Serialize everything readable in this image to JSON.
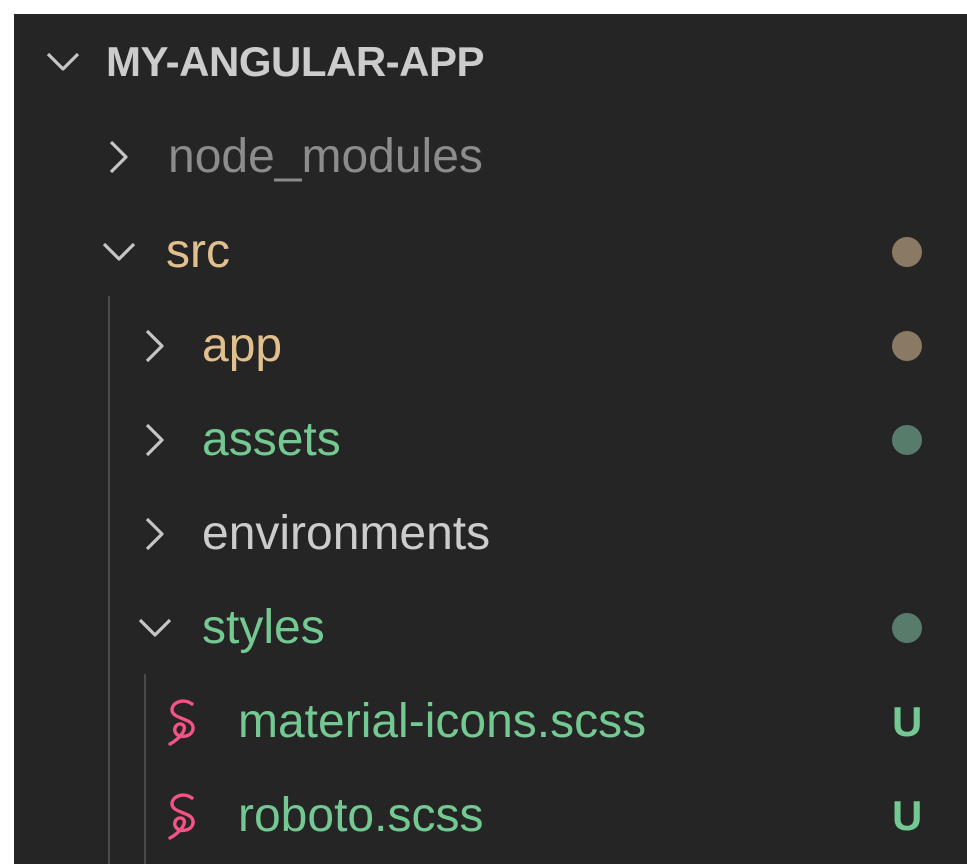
{
  "colors": {
    "background": "#252526",
    "header_text": "#cccccc",
    "chevron": "#c5c5c5",
    "ignored_text": "#8c8c8c",
    "modified_text": "#e2c08d",
    "untracked_text": "#73c991",
    "default_text": "#cccccc",
    "modified_dot": "#8a7a63",
    "untracked_dot": "#587c6c",
    "sass_icon": "#f55385"
  },
  "explorer": {
    "root": {
      "label": "MY-ANGULAR-APP",
      "expanded": true
    },
    "items": [
      {
        "label": "node_modules",
        "type": "folder",
        "expanded": false,
        "status": "ignored",
        "decoration": ""
      },
      {
        "label": "src",
        "type": "folder",
        "expanded": true,
        "status": "modified",
        "decoration": "dot"
      },
      {
        "label": "app",
        "type": "folder",
        "expanded": false,
        "status": "modified",
        "decoration": "dot"
      },
      {
        "label": "assets",
        "type": "folder",
        "expanded": false,
        "status": "untracked",
        "decoration": "dot"
      },
      {
        "label": "environments",
        "type": "folder",
        "expanded": false,
        "status": "none",
        "decoration": ""
      },
      {
        "label": "styles",
        "type": "folder",
        "expanded": true,
        "status": "untracked",
        "decoration": "dot"
      },
      {
        "label": "material-icons.scss",
        "type": "file",
        "icon": "sass-icon",
        "status": "untracked",
        "decoration": "U"
      },
      {
        "label": "roboto.scss",
        "type": "file",
        "icon": "sass-icon",
        "status": "untracked",
        "decoration": "U"
      }
    ]
  }
}
